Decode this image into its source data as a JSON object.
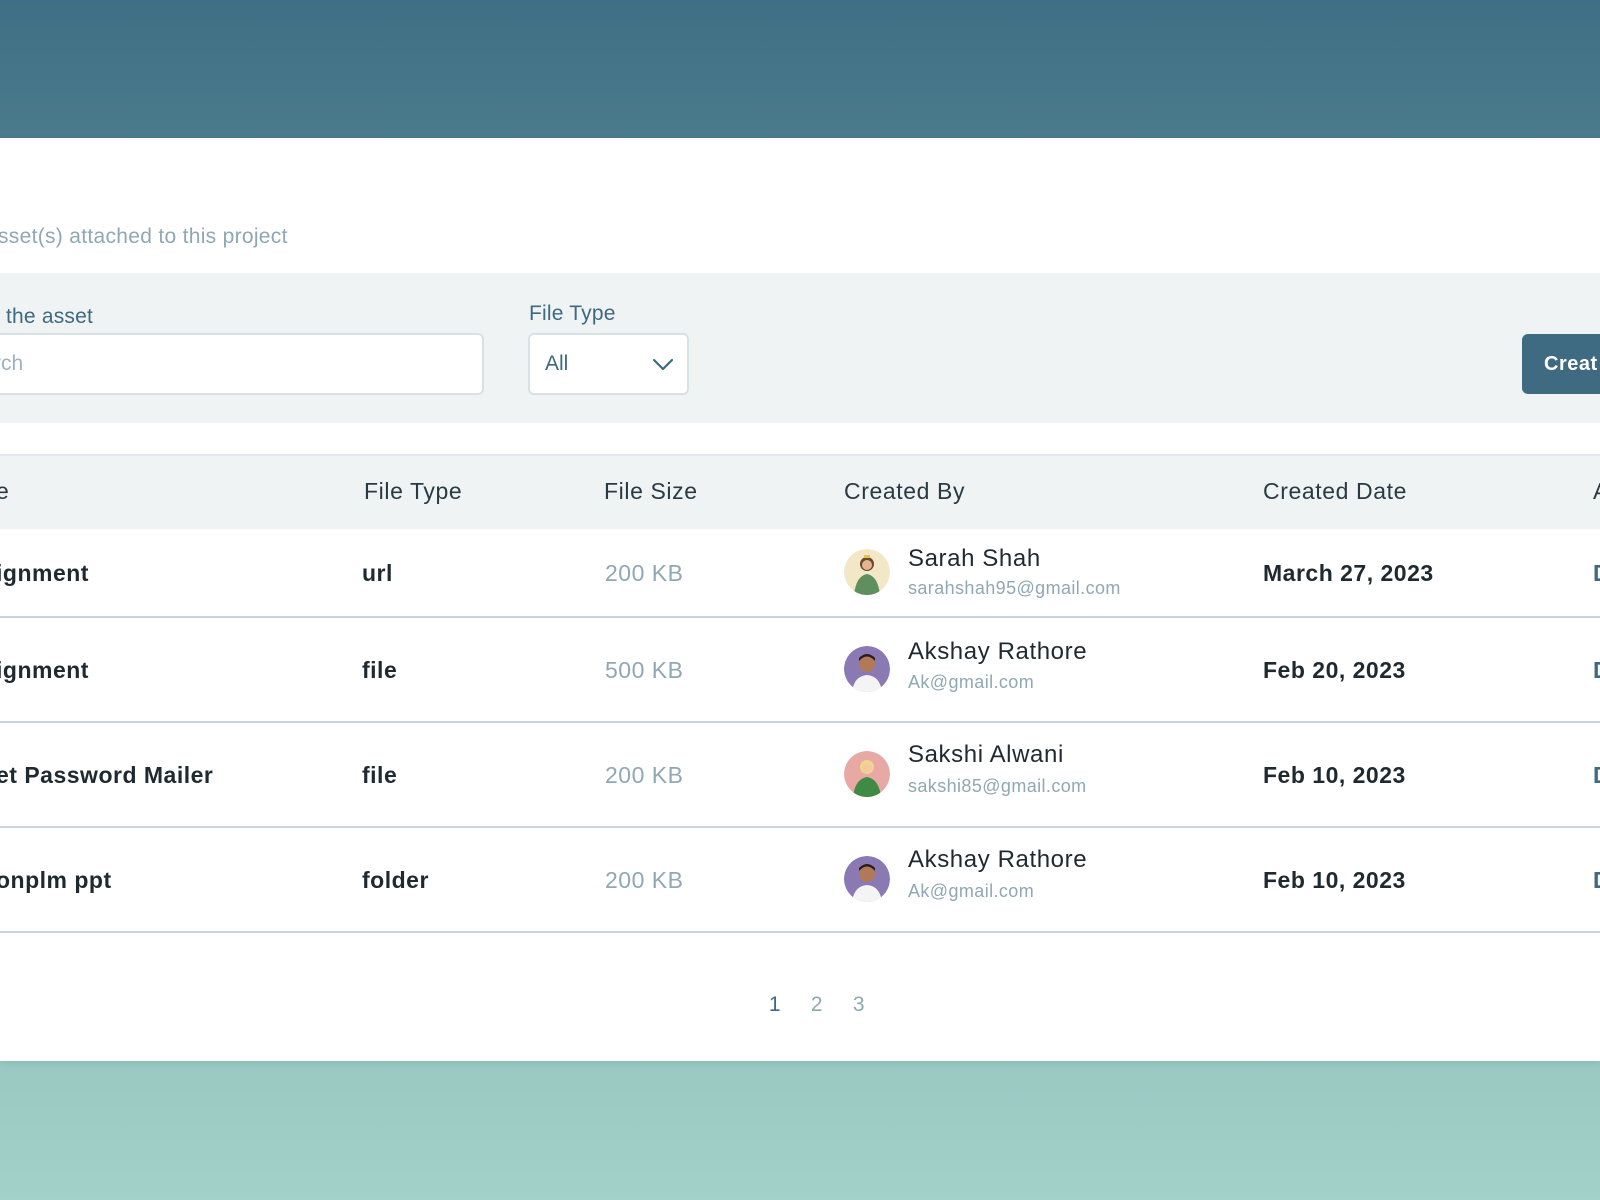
{
  "page": {
    "subtitle": "sset(s) attached to this project"
  },
  "filters": {
    "search_label": "the asset",
    "search_placeholder": "rch",
    "file_type_label": "File Type",
    "file_type_value": "All",
    "create_label": "Creat"
  },
  "table": {
    "headers": {
      "name": "e",
      "file_type": "File Type",
      "file_size": "File Size",
      "created_by": "Created By",
      "created_date": "Created Date",
      "action": "A"
    },
    "rows": [
      {
        "name": "ignment",
        "file_type": "url",
        "file_size": "200 KB",
        "creator_name": "Sarah Shah",
        "creator_email": "sarahshah95@gmail.com",
        "date": "March 27, 2023",
        "action": "D",
        "avatar_color": "#f2e7c7"
      },
      {
        "name": "ignment",
        "file_type": "file",
        "file_size": "500 KB",
        "creator_name": "Akshay Rathore",
        "creator_email": "Ak@gmail.com",
        "date": "Feb 20, 2023",
        "action": "D",
        "avatar_color": "#8a79b3"
      },
      {
        "name": "et Password Mailer",
        "file_type": "file",
        "file_size": "200 KB",
        "creator_name": "Sakshi Alwani",
        "creator_email": "sakshi85@gmail.com",
        "date": "Feb 10, 2023",
        "action": "D",
        "avatar_color": "#e8a9a4"
      },
      {
        "name": "onplm ppt",
        "file_type": "folder",
        "file_size": "200 KB",
        "creator_name": "Akshay Rathore",
        "creator_email": "Ak@gmail.com",
        "date": "Feb 10, 2023",
        "action": "D",
        "avatar_color": "#8a79b3"
      }
    ]
  },
  "pagination": {
    "pages": [
      "1",
      "2",
      "3"
    ],
    "active": "1"
  },
  "colors": {
    "header_band": "#3f6f84",
    "accent": "#3e6b82",
    "muted_text": "#8fa8b3"
  }
}
